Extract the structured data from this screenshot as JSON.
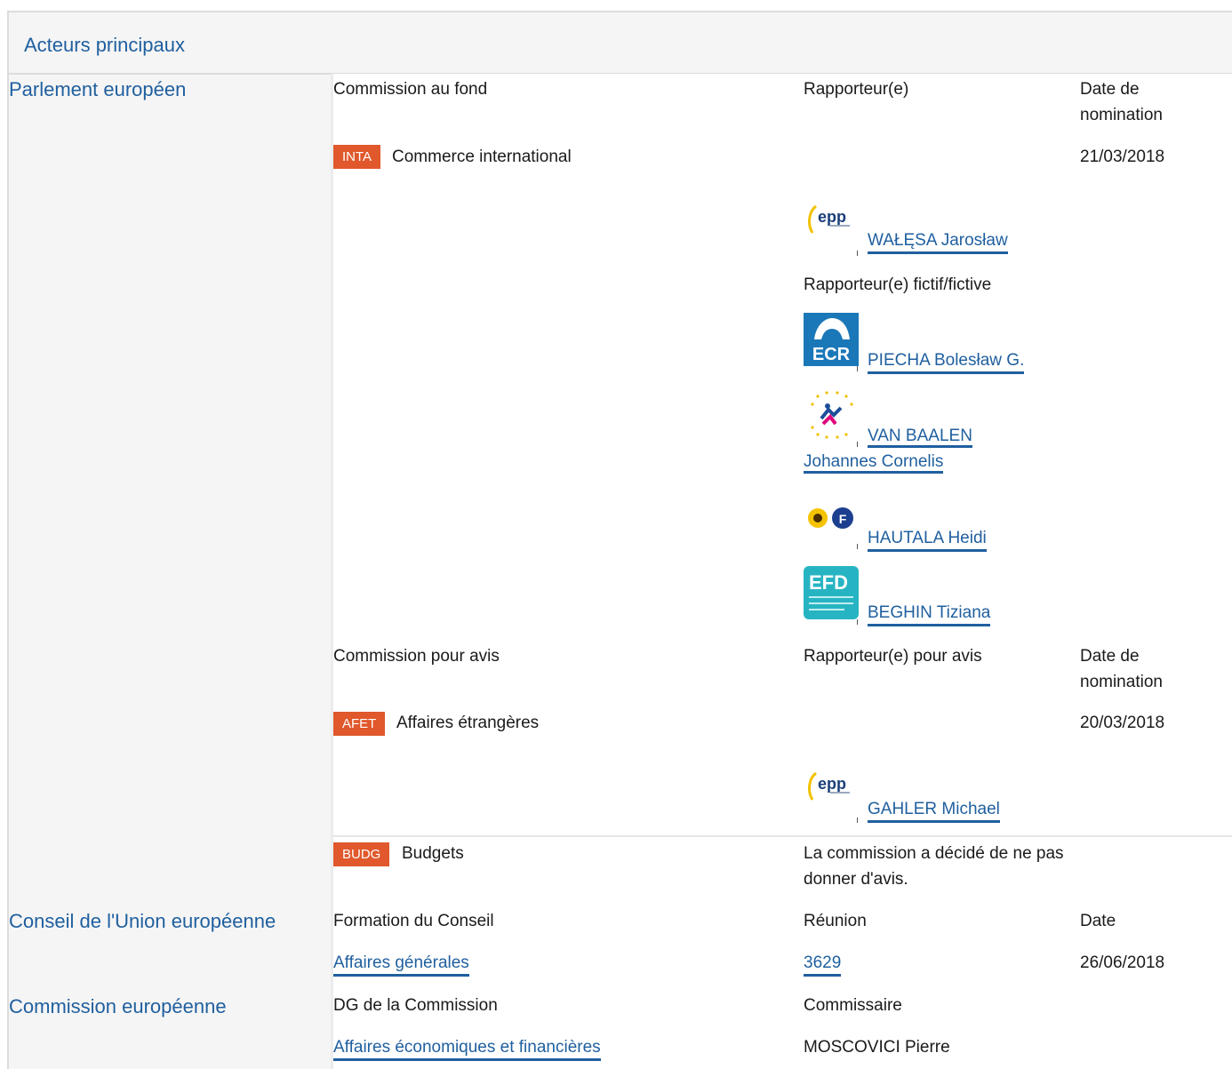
{
  "header": {
    "title": "Acteurs principaux"
  },
  "actors": {
    "parliament": "Parlement européen",
    "council": "Conseil de l'Union européenne",
    "commission": "Commission européenne"
  },
  "lead": {
    "col_committee": "Commission au fond",
    "col_rapporteur": "Rapporteur(e)",
    "col_date": "Date de nomination",
    "committee_code": "INTA",
    "committee_name": "Commerce international",
    "date": "21/03/2018",
    "rapporteur": "WAŁĘSA Jarosław",
    "shadow_label": "Rapporteur(e) fictif/fictive",
    "shadows": [
      {
        "name": "PIECHA Bolesław G.",
        "logo": "ECR"
      },
      {
        "name": "VAN BAALEN Johannes Cornelis",
        "logo": "ALDE"
      },
      {
        "name": "HAUTALA Heidi",
        "logo": "Greens/EFA"
      },
      {
        "name": "BEGHIN Tiziana",
        "logo": "EFDD"
      }
    ]
  },
  "opinion": {
    "col_committee": "Commission pour avis",
    "col_rapporteur": "Rapporteur(e) pour avis",
    "col_date": "Date de nomination",
    "afet_code": "AFET",
    "afet_name": "Affaires étrangères",
    "afet_date": "20/03/2018",
    "afet_rapporteur": "GAHLER Michael",
    "budg_code": "BUDG",
    "budg_name": "Budgets",
    "budg_note": "La commission a décidé de ne pas donner d'avis."
  },
  "council": {
    "col_formation": "Formation du Conseil",
    "col_meeting": "Réunion",
    "col_date": "Date",
    "formation": "Affaires générales",
    "meeting": "3629",
    "date": "26/06/2018"
  },
  "commission": {
    "col_dg": "DG de la Commission",
    "col_commissioner": "Commissaire",
    "dg": "Affaires économiques et financières",
    "commissioner": "MOSCOVICI Pierre"
  },
  "logos": {
    "epp": "epp"
  },
  "colors": {
    "badge": "#e0582b",
    "link": "#1f5f9f"
  }
}
